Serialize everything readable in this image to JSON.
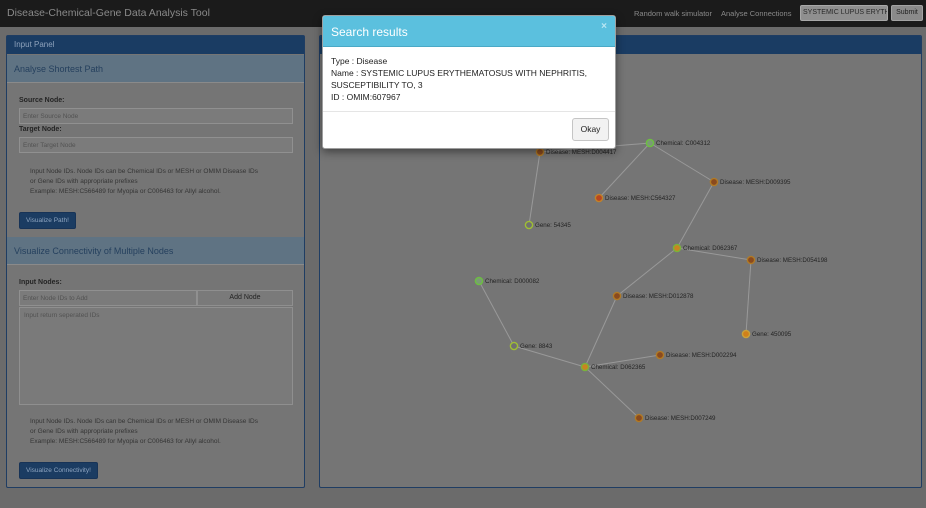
{
  "navbar": {
    "brand": "Disease-Chemical-Gene Data Analysis Tool",
    "links": [
      "Random walk simulator",
      "Analyse Connections"
    ],
    "search_value": "SYSTEMIC LUPUS ERYTHE",
    "submit_label": "Submit"
  },
  "input_panel": {
    "title": "Input Panel",
    "shortest_path": {
      "title": "Analyse Shortest Path",
      "source_label": "Source Node:",
      "source_placeholder": "Enter Source Node",
      "target_label": "Target Node:",
      "target_placeholder": "Enter Target Node",
      "help": [
        "Input Node IDs. Node IDs can be Chemical IDs or MESH or OMIM Disease IDs",
        "or Gene IDs with appropriate prefixes",
        "Example: MESH:C566489 for Myopia or C006463 for Allyl alcohol."
      ],
      "button": "Visualize Path!"
    },
    "connectivity": {
      "title": "Visualize Connectivity of Multiple Nodes",
      "nodes_label": "Input Nodes:",
      "node_placeholder": "Enter Node IDs to Add",
      "add_button": "Add Node",
      "textarea_placeholder": "Input return seperated IDs",
      "help": [
        "Input Node IDs. Node IDs can be Chemical IDs or MESH or OMIM Disease IDs",
        "or Gene IDs with appropriate prefixes",
        "Example: MESH:C566489 for Myopia or C006463 for Allyl alcohol."
      ],
      "button": "Visualize Connectivity!"
    }
  },
  "graph": {
    "colors": {
      "disease_fill": "#8a4a1e",
      "disease_stroke": "#b07a26",
      "chemical_fill": "#c98520",
      "chemical_stroke": "#7ab33a",
      "gene_fill": "#707070",
      "gene_stroke": "#9fbf33",
      "edge": "#999999"
    },
    "nodes": [
      {
        "id": "mesh_d004417",
        "label": "Disease: MESH:D004417",
        "kind": "disease"
      },
      {
        "id": "c004312",
        "label": "Chemical: C004312",
        "kind": "chemical_green"
      },
      {
        "id": "mesh_d009395",
        "label": "Disease: MESH:D009395",
        "kind": "disease"
      },
      {
        "id": "mesh_c564327",
        "label": "Disease: MESH:C564327",
        "kind": "disease_red"
      },
      {
        "id": "gene_54345",
        "label": "Gene: 54345",
        "kind": "gene"
      },
      {
        "id": "d062367",
        "label": "Chemical: D062367",
        "kind": "chemical"
      },
      {
        "id": "mesh_d054198",
        "label": "Disease: MESH:D054198",
        "kind": "disease"
      },
      {
        "id": "d000082",
        "label": "Chemical: D000082",
        "kind": "chemical_green"
      },
      {
        "id": "mesh_d012878",
        "label": "Disease: MESH:D012878",
        "kind": "disease"
      },
      {
        "id": "gene_450095",
        "label": "Gene: 450095",
        "kind": "gene_orange"
      },
      {
        "id": "gene_8843",
        "label": "Gene: 8843",
        "kind": "gene"
      },
      {
        "id": "mesh_d002294",
        "label": "Disease: MESH:D002294",
        "kind": "disease"
      },
      {
        "id": "d062365",
        "label": "Chemical: D062365",
        "kind": "chemical"
      },
      {
        "id": "mesh_d007249",
        "label": "Disease: MESH:D007249",
        "kind": "disease"
      }
    ],
    "edges": [
      [
        "mesh_d004417",
        "c004312"
      ],
      [
        "mesh_d004417",
        "gene_54345"
      ],
      [
        "c004312",
        "mesh_c564327"
      ],
      [
        "c004312",
        "mesh_d009395"
      ],
      [
        "mesh_d009395",
        "d062367"
      ],
      [
        "d062367",
        "mesh_d054198"
      ],
      [
        "d062367",
        "mesh_d012878"
      ],
      [
        "mesh_d054198",
        "gene_450095"
      ],
      [
        "d000082",
        "gene_8843"
      ],
      [
        "gene_8843",
        "d062365"
      ],
      [
        "mesh_d012878",
        "d062365"
      ],
      [
        "d062365",
        "mesh_d002294"
      ],
      [
        "d062365",
        "mesh_d007249"
      ]
    ]
  },
  "modal": {
    "title": "Search results",
    "close": "×",
    "lines": [
      "Type : Disease",
      "Name : SYSTEMIC LUPUS ERYTHEMATOSUS WITH NEPHRITIS,",
      "SUSCEPTIBILITY TO, 3",
      "ID : OMIM:607967"
    ],
    "okay": "Okay"
  }
}
